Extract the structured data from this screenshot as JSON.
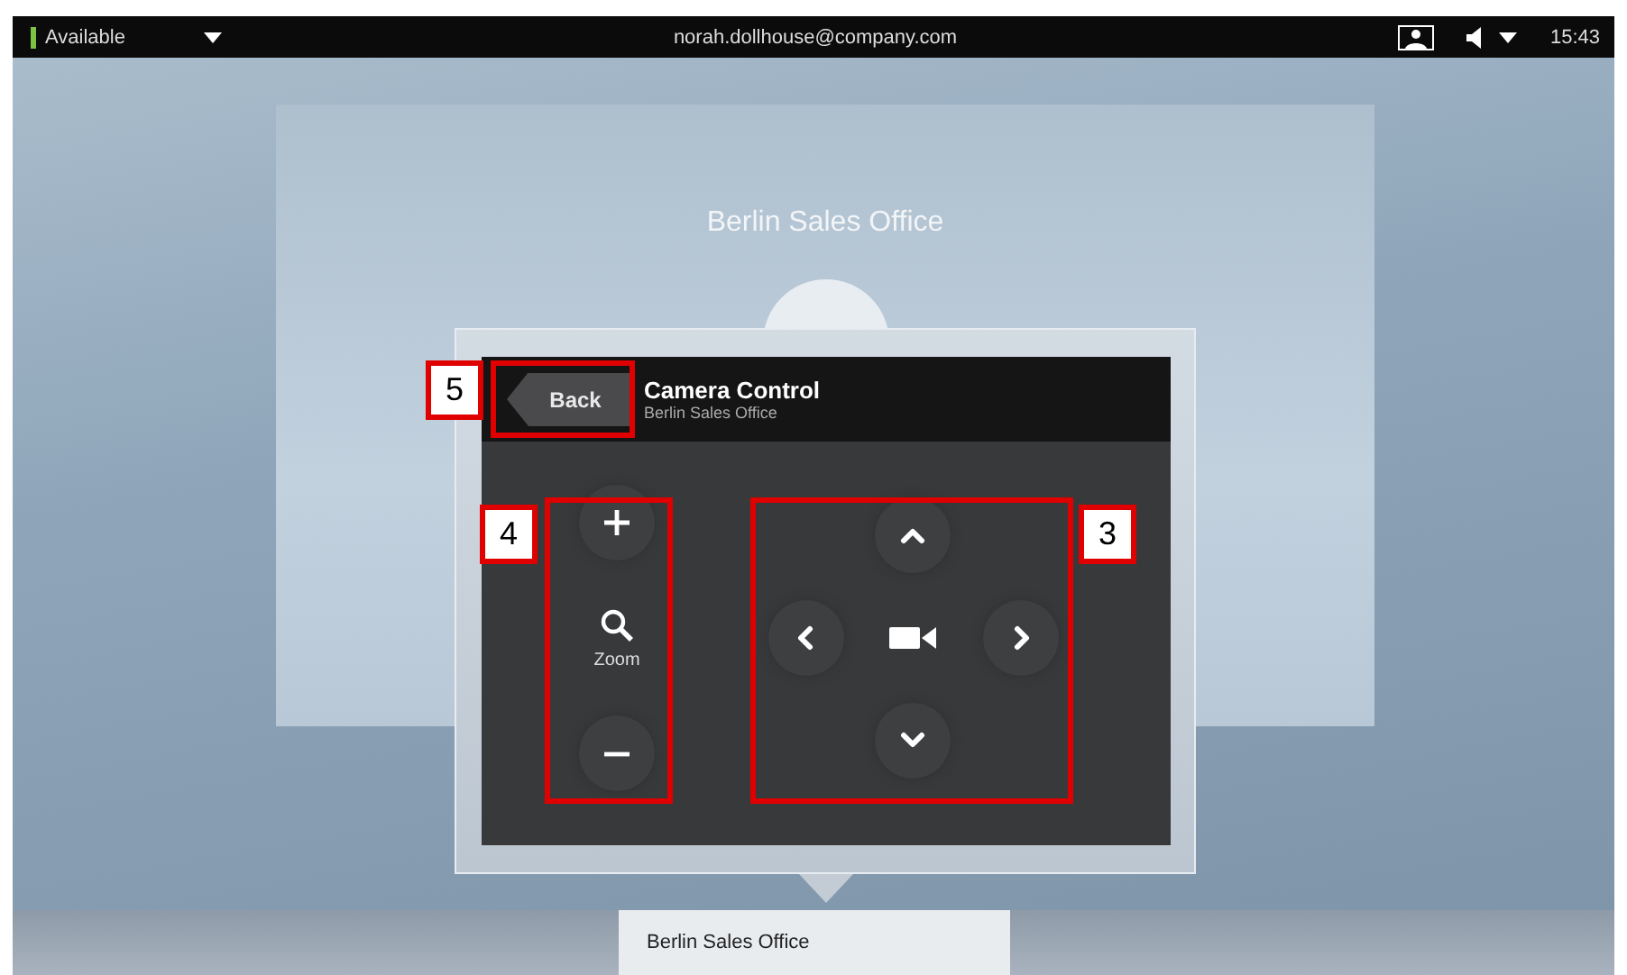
{
  "status_bar": {
    "presence": "Available",
    "account": "norah.dollhouse@company.com",
    "time": "15:43"
  },
  "call_tile": {
    "name": "Berlin Sales Office"
  },
  "camera_control": {
    "back": "Back",
    "title": "Camera Control",
    "subtitle": "Berlin Sales Office",
    "zoom_label": "Zoom"
  },
  "bottom_tabs": [
    {
      "label": "Berlin Sales Office",
      "selected": true
    }
  ],
  "annotations": [
    {
      "label": "5",
      "kind": "back"
    },
    {
      "label": "4",
      "kind": "zoom"
    },
    {
      "label": "3",
      "kind": "pan"
    }
  ]
}
